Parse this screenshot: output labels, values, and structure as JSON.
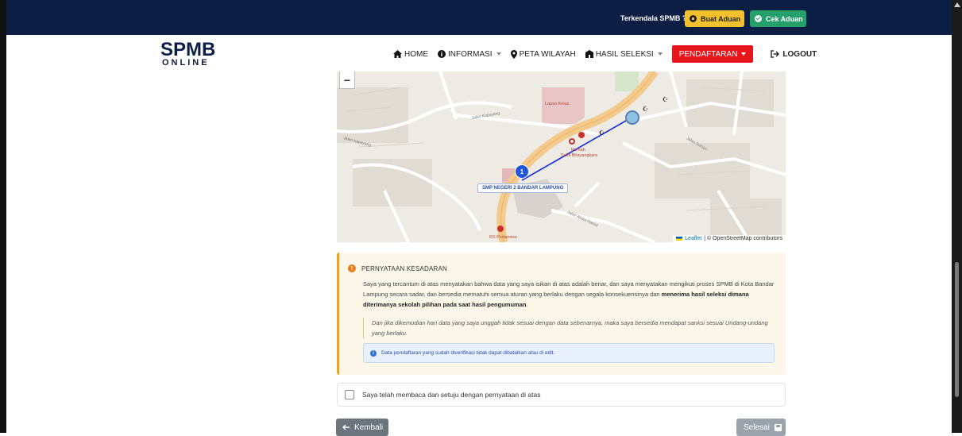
{
  "topbar": {
    "help_text": "Terkendala SPMB ?",
    "buat_aduan_label": "Buat Aduan",
    "cek_aduan_label": "Cek Aduan",
    "bg_color": "#0d1e45",
    "buat_aduan_color": "#f4c12e",
    "cek_aduan_color": "#25a06a"
  },
  "logo": {
    "line1": "SPMB",
    "line2": "ONLINE"
  },
  "nav": {
    "home": "HOME",
    "informasi": "INFORMASI",
    "peta_wilayah": "PETA WILAYAH",
    "hasil_seleksi": "HASIL SELEKSI",
    "pendaftaran": "PENDAFTARAN",
    "logout": "LOGOUT",
    "pendaftaran_color": "#e6161c"
  },
  "map": {
    "zoom_out": "−",
    "marker_number": "1",
    "school_label": "SMP NEGERI 2 BANDAR LAMPUNG",
    "attribution_leaflet": "Leaflet",
    "attribution_rest": "| © OpenStreetMap contributors",
    "street_labels": [
      "Jalan Kapayang",
      "Jalan Kapayang",
      "Lapas Kelas I",
      "Rumah Sakit Bhayangkara",
      "RS Pertamina-",
      "Jalan Abdul Hamid",
      "Jalan Sutoyo"
    ]
  },
  "statement": {
    "title": "PERNYATAAN KESADARAN",
    "body_part1": "Saya yang tercantum di atas menyatakan bahwa data yang saya isikan di atas adalah benar, dan saya menyatakan mengikuti proses SPMB di Kota Bandar Lampung secara sadar, dan bersedia mematuhi semua aturan yang berlaku dengan segala konsekuensinya dan ",
    "body_bold": "menerima hasil seleksi dimana diterimanya sekolah pilihan pada saat hasil pengumuman",
    "body_end": ".",
    "quote": "Dan jika dikemudian hari data yang saya unggah tidak sesuai dengan data sebenarnya, maka saya bersedia mendapat sanksi sesuai Undang-undang yang berlaku.",
    "info": "Data pendaftaran yang sudah diverifikasi tidak dapat dibatalkan atau di edit.",
    "accent_color": "#f0a30a"
  },
  "agreement": {
    "label": "Saya telah membaca dan setuju dengan pernyataan di atas",
    "checked": false
  },
  "actions": {
    "back_label": "Kembali",
    "done_label": "Selesai"
  }
}
